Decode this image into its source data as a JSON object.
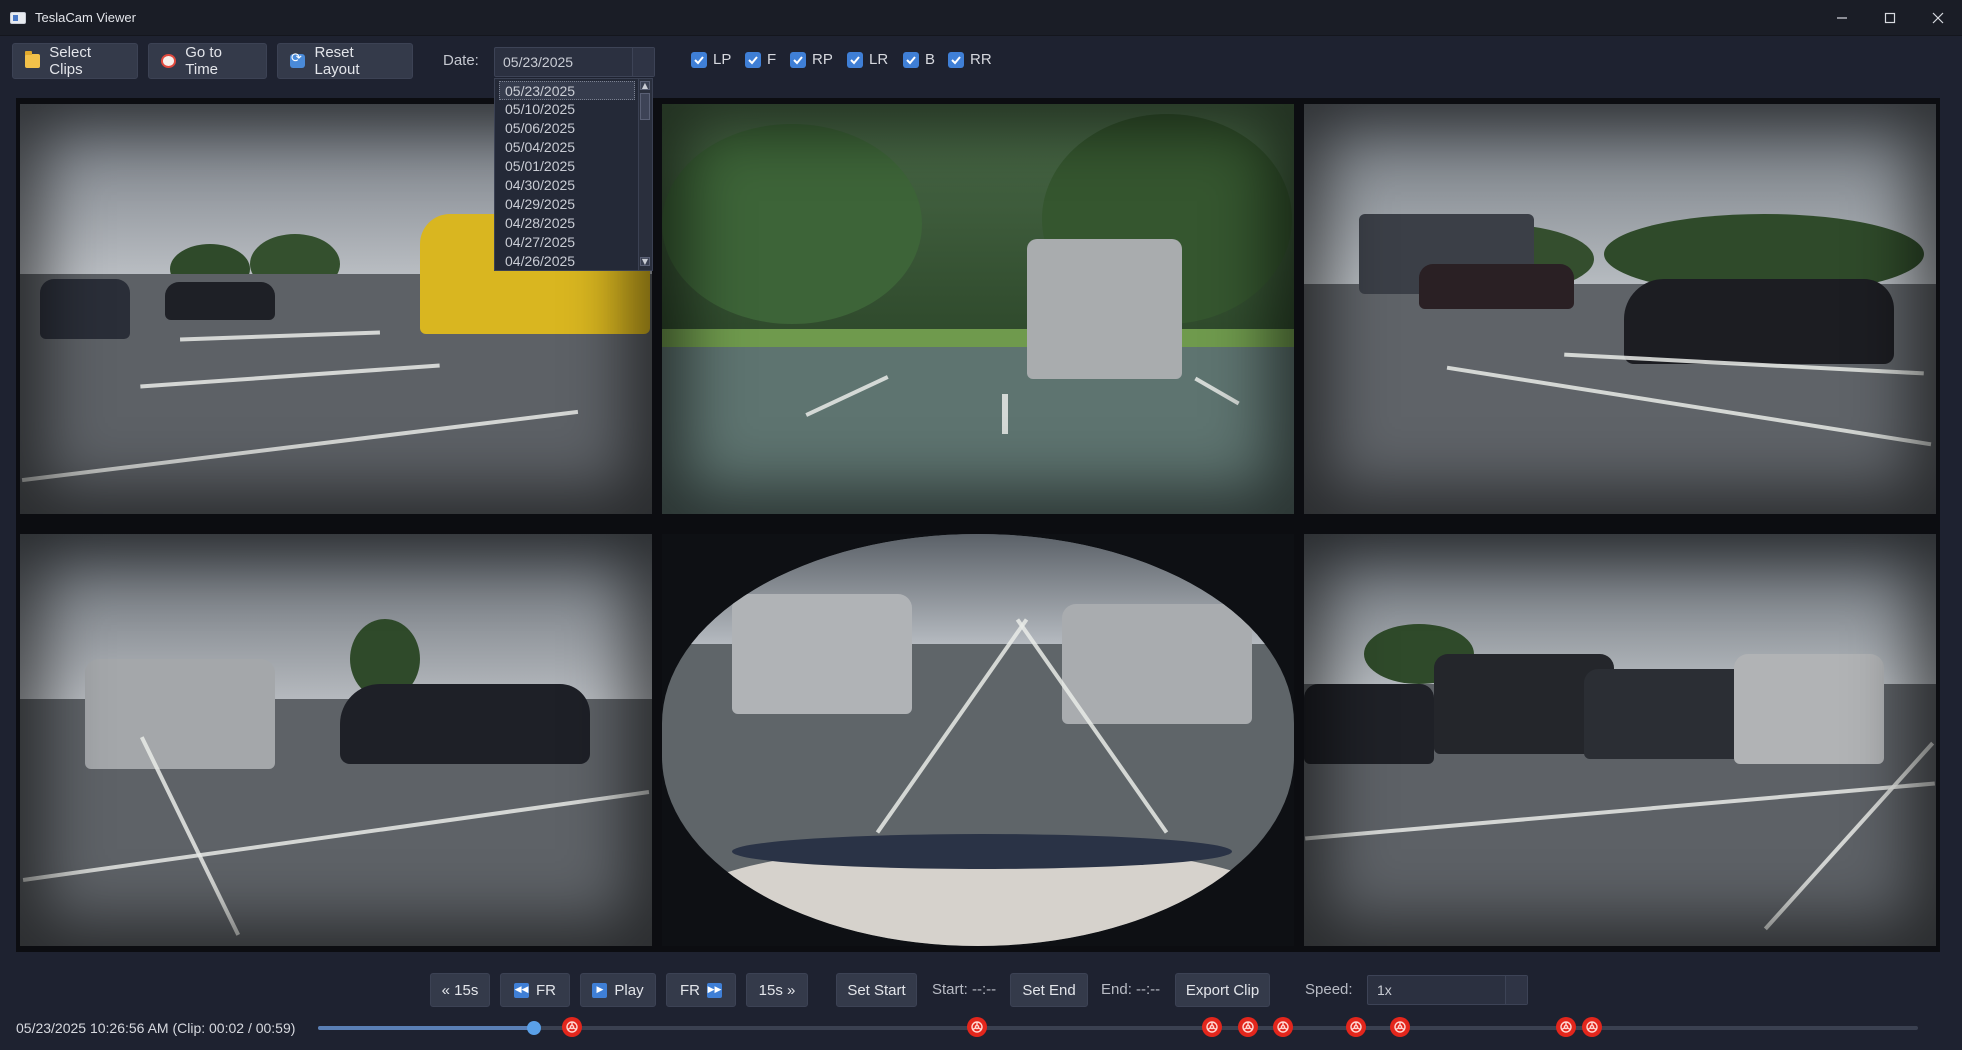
{
  "window": {
    "title": "TeslaCam Viewer",
    "controls": [
      "minimize",
      "maximize",
      "close"
    ]
  },
  "toolbar": {
    "select_clips": "Select Clips",
    "go_to_time": "Go to Time",
    "reset_layout": "Reset Layout",
    "date_label": "Date:",
    "date_value": "05/23/2025",
    "date_options": [
      "05/23/2025",
      "05/10/2025",
      "05/06/2025",
      "05/04/2025",
      "05/01/2025",
      "04/30/2025",
      "04/29/2025",
      "04/28/2025",
      "04/27/2025",
      "04/26/2025"
    ],
    "cameras": [
      {
        "label": "LP",
        "checked": true
      },
      {
        "label": "F",
        "checked": true
      },
      {
        "label": "RP",
        "checked": true
      },
      {
        "label": "LR",
        "checked": true
      },
      {
        "label": "B",
        "checked": true
      },
      {
        "label": "RR",
        "checked": true
      }
    ]
  },
  "controls": {
    "back15": "« 15s",
    "frame_back": "FR",
    "play": "Play",
    "frame_fwd": "FR",
    "fwd15": "15s »",
    "set_start": "Set Start",
    "start_text": "Start: --:--",
    "set_end": "Set End",
    "end_text": "End: --:--",
    "export_clip": "Export Clip",
    "speed_label": "Speed:",
    "speed_value": "1x"
  },
  "status": {
    "text": "05/23/2025 10:26:56 AM (Clip: 00:02 / 00:59)",
    "progress_fraction": 0.135,
    "event_markers": [
      0.159,
      0.412,
      0.559,
      0.581,
      0.603,
      0.649,
      0.676,
      0.78,
      0.796
    ]
  },
  "colors": {
    "accent": "#3f7fd6",
    "event_marker": "#e3261c",
    "background": "#1e2230"
  }
}
